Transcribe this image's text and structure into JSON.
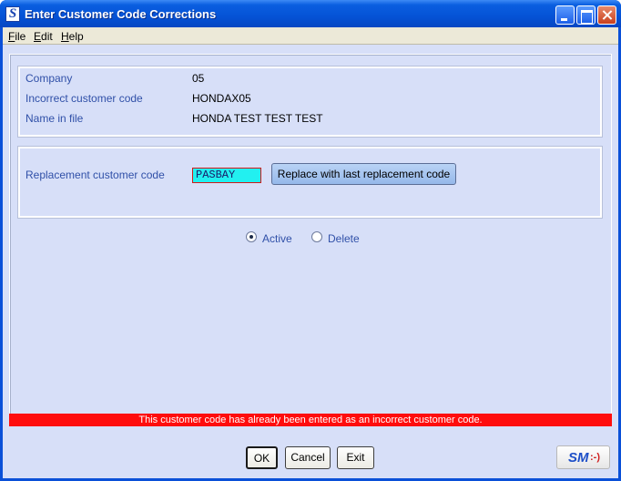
{
  "window": {
    "title": "Enter Customer Code Corrections",
    "app_icon": "S"
  },
  "menu": {
    "items": [
      "File",
      "Edit",
      "Help"
    ]
  },
  "info": {
    "company_label": "Company",
    "company_value": "05",
    "incorrect_label": "Incorrect customer code",
    "incorrect_value": "HONDAX05",
    "name_label": "Name in file",
    "name_value": "HONDA TEST TEST TEST"
  },
  "replacement": {
    "label": "Replacement customer code",
    "value": "PASBAY",
    "replace_button": "Replace with last replacement code"
  },
  "status_options": {
    "active_label": "Active",
    "delete_label": "Delete",
    "selected": "Active"
  },
  "error_message": "This customer code has already been entered as an incorrect customer code.",
  "buttons": {
    "ok": "OK",
    "cancel": "Cancel",
    "exit": "Exit"
  },
  "logo": {
    "text": "SM",
    "face": ":-)"
  },
  "colors": {
    "titlebar": "#0553d6",
    "client_bg": "#d7dff8",
    "label_text": "#3050a8",
    "input_bg": "#22f0f0",
    "error_bar": "#ff0d0d",
    "replace_button_bg": "#a9c8f0"
  }
}
